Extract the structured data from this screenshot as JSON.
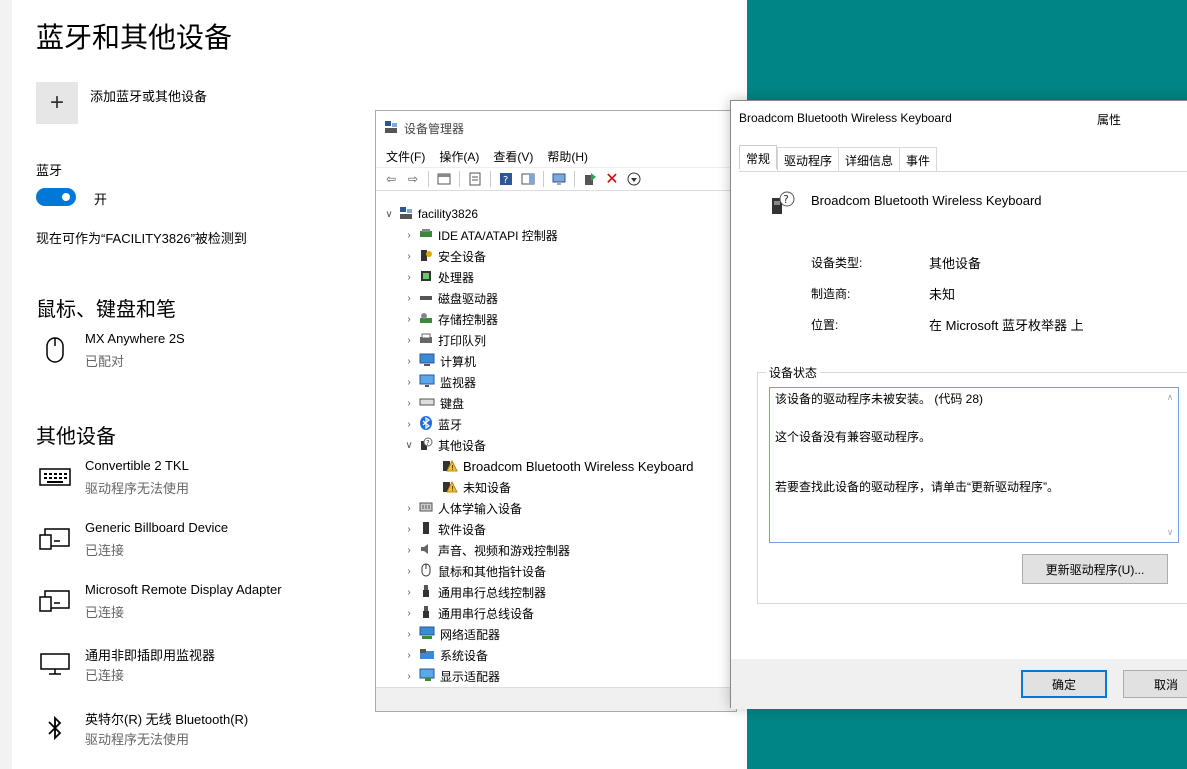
{
  "settings": {
    "title": "蓝牙和其他设备",
    "add_label": "添加蓝牙或其他设备",
    "add_icon": "plus-icon",
    "bluetooth_label": "蓝牙",
    "toggle_state": "开",
    "discoverable_text": "现在可作为“FACILITY3826”被检测到",
    "mouse_section": "鼠标、键盘和笔",
    "mouse_devices": [
      {
        "name": "MX Anywhere 2S",
        "status": "已配对",
        "icon": "mouse-icon"
      }
    ],
    "other_section": "其他设备",
    "other_devices": [
      {
        "name": "Convertible 2 TKL",
        "status": "驱动程序无法使用",
        "icon": "keyboard-icon"
      },
      {
        "name": "Generic Billboard Device",
        "status": "已连接",
        "icon": "display-device-icon"
      },
      {
        "name": "Microsoft Remote Display Adapter",
        "status": "已连接",
        "icon": "display-device-icon"
      },
      {
        "name": "通用非即插即用监视器",
        "status": "已连接",
        "icon": "monitor-icon"
      },
      {
        "name": "英特尔(R) 无线 Bluetooth(R)",
        "status": "驱动程序无法使用",
        "icon": "bluetooth-icon"
      }
    ]
  },
  "devmgr": {
    "title": "设备管理器",
    "menu": [
      "文件(F)",
      "操作(A)",
      "查看(V)",
      "帮助(H)"
    ],
    "root": "facility3826",
    "nodes": [
      {
        "label": "IDE ATA/ATAPI 控制器",
        "icon": "ide-controller-icon"
      },
      {
        "label": "安全设备",
        "icon": "security-device-icon"
      },
      {
        "label": "处理器",
        "icon": "processor-icon"
      },
      {
        "label": "磁盘驱动器",
        "icon": "disk-drive-icon"
      },
      {
        "label": "存储控制器",
        "icon": "storage-controller-icon"
      },
      {
        "label": "打印队列",
        "icon": "printer-icon"
      },
      {
        "label": "计算机",
        "icon": "computer-icon"
      },
      {
        "label": "监视器",
        "icon": "monitor-icon"
      },
      {
        "label": "键盘",
        "icon": "keyboard-icon"
      },
      {
        "label": "蓝牙",
        "icon": "bluetooth-icon"
      },
      {
        "label": "其他设备",
        "icon": "unknown-device-icon",
        "expanded": true
      },
      {
        "label": "Broadcom Bluetooth Wireless  Keyboard",
        "icon": "warning-device-icon",
        "child": true
      },
      {
        "label": "未知设备",
        "icon": "warning-device-icon",
        "child": true
      },
      {
        "label": "人体学输入设备",
        "icon": "hid-icon"
      },
      {
        "label": "软件设备",
        "icon": "software-device-icon"
      },
      {
        "label": "声音、视频和游戏控制器",
        "icon": "sound-icon"
      },
      {
        "label": "鼠标和其他指针设备",
        "icon": "mouse-icon"
      },
      {
        "label": "通用串行总线控制器",
        "icon": "usb-icon"
      },
      {
        "label": "通用串行总线设备",
        "icon": "usb-icon"
      },
      {
        "label": "网络适配器",
        "icon": "network-adapter-icon"
      },
      {
        "label": "系统设备",
        "icon": "system-device-icon"
      },
      {
        "label": "显示适配器",
        "icon": "display-adapter-icon"
      }
    ]
  },
  "props": {
    "title": "Broadcom Bluetooth Wireless  Keyboard",
    "title_right": "属性",
    "tabs": [
      "常规",
      "驱动程序",
      "详细信息",
      "事件"
    ],
    "device_name": "Broadcom Bluetooth Wireless  Keyboard",
    "rows": [
      {
        "label": "设备类型:",
        "value": "其他设备"
      },
      {
        "label": "制造商:",
        "value": "未知"
      },
      {
        "label": "位置:",
        "value": "在 Microsoft 蓝牙枚举器 上"
      }
    ],
    "status_group": "设备状态",
    "status_lines": [
      "该设备的驱动程序未被安装。 (代码 28)",
      "这个设备没有兼容驱动程序。",
      "若要查找此设备的驱动程序，请单击“更新驱动程序”。"
    ],
    "update_button": "更新驱动程序(U)...",
    "ok_button": "确定",
    "cancel_button": "取消"
  }
}
